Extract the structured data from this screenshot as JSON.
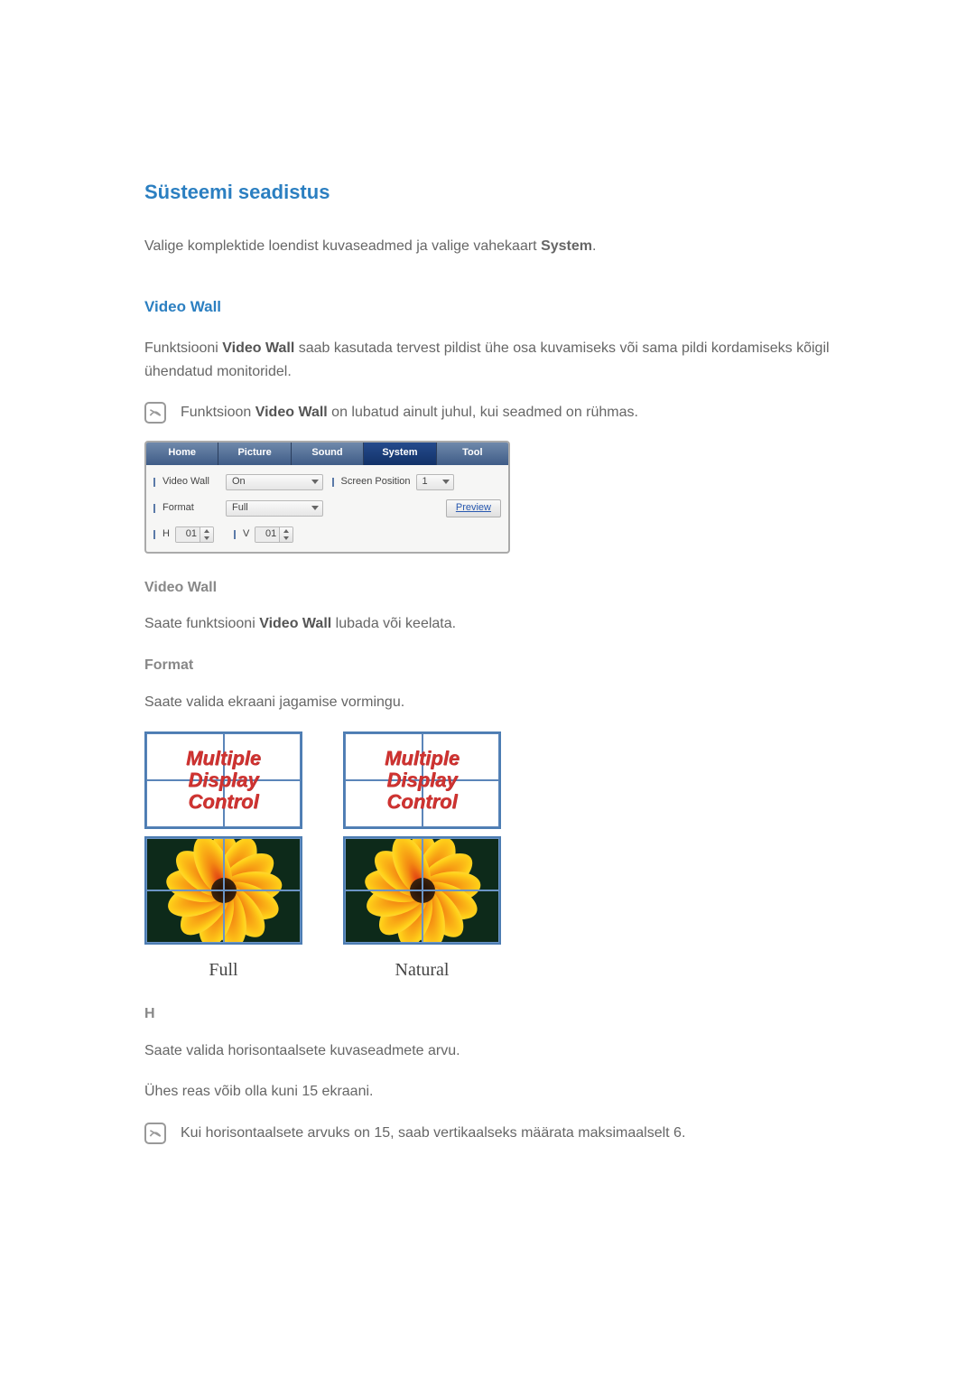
{
  "heading": "Süsteemi seadistus",
  "intro_prefix": "Valige komplektide loendist kuvaseadmed ja valige vahekaart ",
  "intro_bold": "System",
  "intro_suffix": ".",
  "section_videowall": "Video Wall",
  "vw_desc_prefix": "Funktsiooni ",
  "vw_desc_bold": "Video Wall",
  "vw_desc_suffix": " saab kasutada tervest pildist ühe osa kuvamiseks või sama pildi kordamiseks kõigil ühendatud monitoridel.",
  "note1_prefix": "Funktsioon ",
  "note1_bold": "Video Wall",
  "note1_suffix": " on lubatud ainult juhul, kui seadmed on rühmas.",
  "panel": {
    "tabs": [
      "Home",
      "Picture",
      "Sound",
      "System",
      "Tool"
    ],
    "selected_tab_index": 3,
    "labels": {
      "video_wall": "Video Wall",
      "format": "Format",
      "h": "H",
      "v": "V",
      "screen_position": "Screen Position"
    },
    "values": {
      "video_wall": "On",
      "format": "Full",
      "h": "01",
      "v": "01",
      "screen_position": "1"
    },
    "preview_btn": "Preview"
  },
  "sub_videowall": "Video Wall",
  "sub_vw_text_prefix": "Saate funktsiooni ",
  "sub_vw_text_bold": "Video Wall",
  "sub_vw_text_suffix": " lubada või keelata.",
  "sub_format": "Format",
  "sub_format_text": "Saate valida ekraani jagamise vormingu.",
  "fig_text_l1": "Multiple",
  "fig_text_l2": "Display",
  "fig_text_l3": "Control",
  "fig_label_full": "Full",
  "fig_label_natural": "Natural",
  "sub_h": "H",
  "sub_h_text1": "Saate valida horisontaalsete kuvaseadmete arvu.",
  "sub_h_text2": "Ühes reas võib olla kuni 15 ekraani.",
  "note2": "Kui horisontaalsete arvuks on 15, saab vertikaalseks määrata maksimaalselt 6."
}
